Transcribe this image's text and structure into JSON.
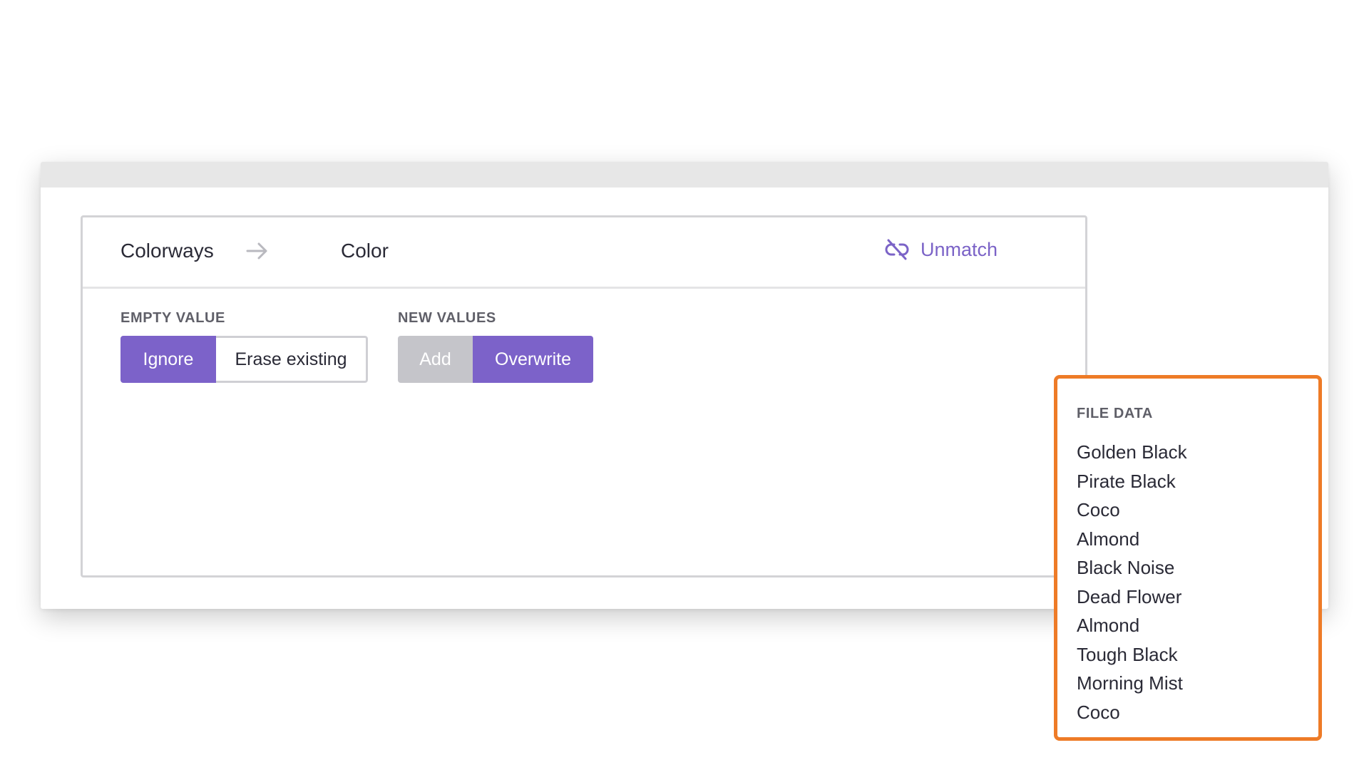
{
  "mapping": {
    "source_field": "Colorways",
    "target_field": "Color",
    "unmatch_label": "Unmatch"
  },
  "empty_value": {
    "label": "EMPTY VALUE",
    "options": [
      "Ignore",
      "Erase existing"
    ],
    "selected": "Ignore"
  },
  "new_values": {
    "label": "NEW VALUES",
    "options": [
      "Add",
      "Overwrite"
    ],
    "selected": "Overwrite"
  },
  "file_data": {
    "title": "FILE DATA",
    "items": [
      "Golden Black",
      "Pirate Black",
      "Coco",
      "Almond",
      "Black Noise",
      "Dead Flower",
      "Almond",
      "Tough Black",
      "Morning Mist",
      "Coco"
    ]
  },
  "colors": {
    "accent": "#7c62c9",
    "highlight_border": "#ee7b27",
    "disabled": "#c5c5ca"
  }
}
